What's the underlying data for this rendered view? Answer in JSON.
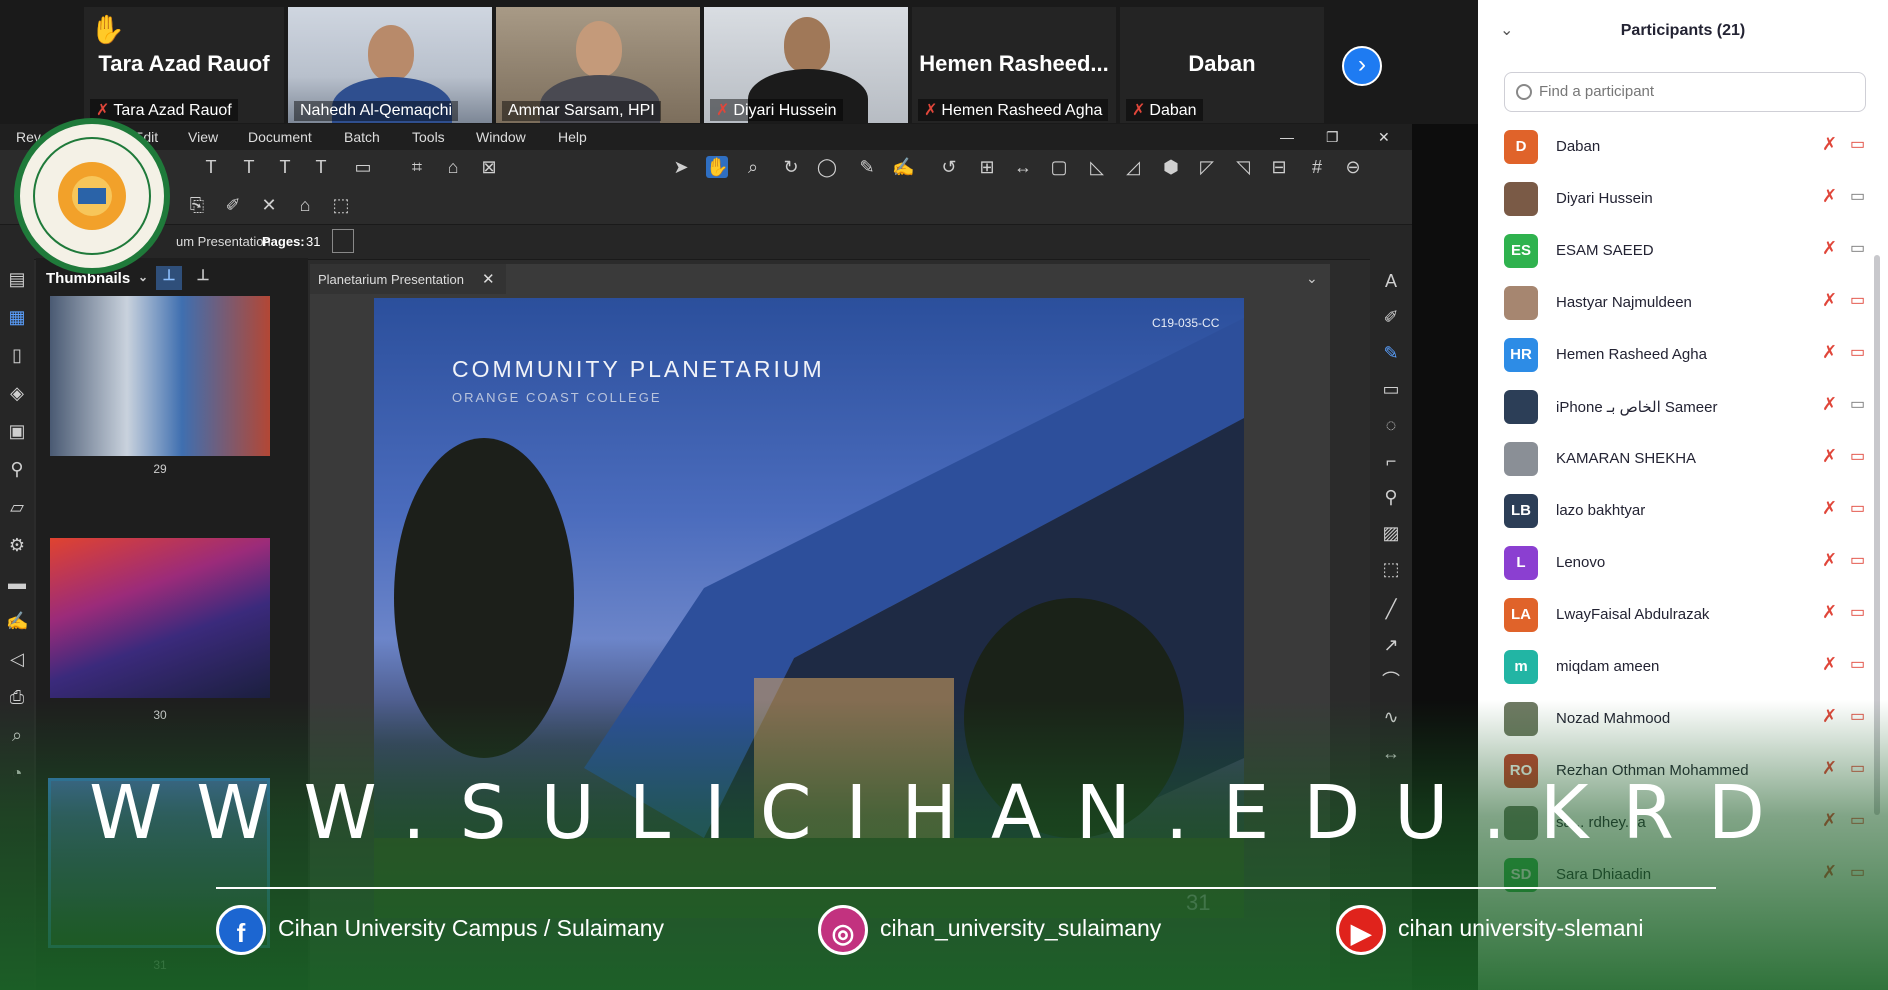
{
  "video_strip": {
    "tiles": [
      {
        "big_name": "Tara Azad Rauof",
        "caption": "Tara Azad Rauof",
        "hand_raised": true
      },
      {
        "big_name": "",
        "caption": "Nahedh Al-Qemaqchi"
      },
      {
        "big_name": "",
        "caption": "Ammar Sarsam, HPI"
      },
      {
        "big_name": "",
        "caption": "Diyari Hussein"
      },
      {
        "big_name": "Hemen  Rasheed...",
        "caption": "Hemen Rasheed Agha"
      },
      {
        "big_name": "Daban",
        "caption": "Daban"
      }
    ],
    "next_icon": "chevron-right-icon"
  },
  "app": {
    "menu": [
      "Rev",
      "Edit",
      "View",
      "Document",
      "Batch",
      "Tools",
      "Window",
      "Help"
    ],
    "doc_info": {
      "name_tail": "um Presentation",
      "pages_label": "Pages:",
      "pages_value": "31"
    },
    "thumbnails_label": "Thumbnails",
    "tab_label": "Planetarium Presentation",
    "thumb_page_numbers": [
      "29",
      "30",
      "31"
    ],
    "page": {
      "code": "C19-035-CC",
      "title": "COMMUNITY PLANETARIUM",
      "subtitle": "ORANGE COAST COLLEGE",
      "page_number": "31"
    }
  },
  "participants": {
    "title": "Participants (21)",
    "search_placeholder": "Find a participant",
    "list": [
      {
        "initials": "D",
        "name": "Daban",
        "color": "#e0632a",
        "photo": false,
        "cam": "off"
      },
      {
        "initials": "",
        "name": "Diyari Hussein",
        "color": "#7a5a46",
        "photo": true,
        "cam": "on"
      },
      {
        "initials": "ES",
        "name": "ESAM SAEED",
        "color": "#2fb24e",
        "photo": false,
        "cam": "on"
      },
      {
        "initials": "",
        "name": "Hastyar Najmuldeen",
        "color": "#a68670",
        "photo": true,
        "cam": "off"
      },
      {
        "initials": "HR",
        "name": "Hemen Rasheed Agha",
        "color": "#2d8ce6",
        "photo": false,
        "cam": "off"
      },
      {
        "initials": "",
        "name": "iPhone الخاص بـ Sameer",
        "color": "#2c3e57",
        "photo": false,
        "cam": "on"
      },
      {
        "initials": "",
        "name": "KAMARAN SHEKHA",
        "color": "#8a8f96",
        "photo": true,
        "cam": "off"
      },
      {
        "initials": "LB",
        "name": "lazo bakhtyar",
        "color": "#2c3e57",
        "photo": false,
        "cam": "off"
      },
      {
        "initials": "L",
        "name": "Lenovo",
        "color": "#8b3fd1",
        "photo": false,
        "cam": "off"
      },
      {
        "initials": "LA",
        "name": "LwayFaisal Abdulrazak",
        "color": "#e0632a",
        "photo": false,
        "cam": "off"
      },
      {
        "initials": "m",
        "name": "miqdam ameen",
        "color": "#22b5a4",
        "photo": false,
        "cam": "off"
      },
      {
        "initials": "",
        "name": "Nozad Mahmood",
        "color": "#6f7a63",
        "photo": true,
        "cam": "off"
      },
      {
        "initials": "RO",
        "name": "Rezhan Othman Mohammed",
        "color": "#c7422f",
        "photo": false,
        "cam": "off"
      },
      {
        "initials": "",
        "name": "sa... rdhey...a",
        "color": "#6a7a66",
        "photo": true,
        "cam": "off"
      },
      {
        "initials": "SD",
        "name": "Sara Dhiaadin",
        "color": "#2fb24e",
        "photo": false,
        "cam": "off"
      }
    ]
  },
  "overlay": {
    "website": "WWW.SULICIHAN.EDU.KRD",
    "socials": [
      {
        "icon": "facebook-icon",
        "label": "Cihan University Campus / Sulaimany",
        "color": "#1c66d1"
      },
      {
        "icon": "instagram-icon",
        "label": "cihan_university_sulaimany",
        "color": "#c2327f"
      },
      {
        "icon": "youtube-icon",
        "label": "cihan university-slemani",
        "color": "#e0231c"
      }
    ]
  }
}
